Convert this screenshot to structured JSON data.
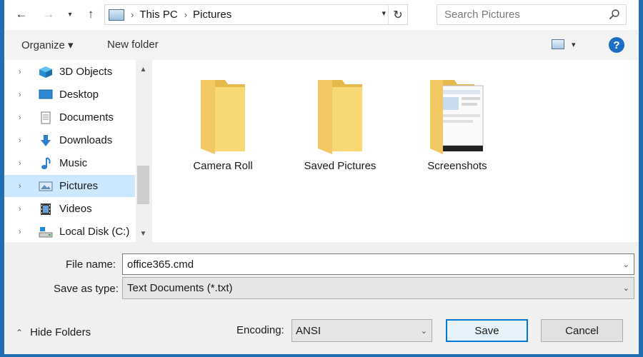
{
  "address_bar": {
    "crumbs": [
      "This PC",
      "Pictures"
    ],
    "search_placeholder": "Search Pictures"
  },
  "toolbar": {
    "organize_label": "Organize ▾",
    "new_folder_label": "New folder",
    "help_label": "?"
  },
  "nav_pane": {
    "items": [
      {
        "label": "3D Objects",
        "icon": "3d-objects-icon"
      },
      {
        "label": "Desktop",
        "icon": "desktop-icon"
      },
      {
        "label": "Documents",
        "icon": "documents-icon"
      },
      {
        "label": "Downloads",
        "icon": "downloads-icon"
      },
      {
        "label": "Music",
        "icon": "music-icon"
      },
      {
        "label": "Pictures",
        "icon": "pictures-icon",
        "selected": true
      },
      {
        "label": "Videos",
        "icon": "videos-icon"
      },
      {
        "label": "Local Disk (C:)",
        "icon": "local-disk-icon"
      }
    ]
  },
  "files": [
    {
      "name": "Camera Roll",
      "icon": "folder-icon"
    },
    {
      "name": "Saved Pictures",
      "icon": "folder-icon"
    },
    {
      "name": "Screenshots",
      "icon": "folder-with-screenshot-icon"
    }
  ],
  "form": {
    "file_name_label": "File name:",
    "file_name_value": "office365.cmd",
    "save_type_label": "Save as type:",
    "save_type_value": "Text Documents (*.txt)",
    "hide_folders_label": "Hide Folders",
    "encoding_label": "Encoding:",
    "encoding_value": "ANSI",
    "save_label": "Save",
    "cancel_label": "Cancel"
  },
  "colors": {
    "selected_bg": "#cce8ff",
    "accent": "#0078d7",
    "folder_yellow": "#f8d775"
  }
}
